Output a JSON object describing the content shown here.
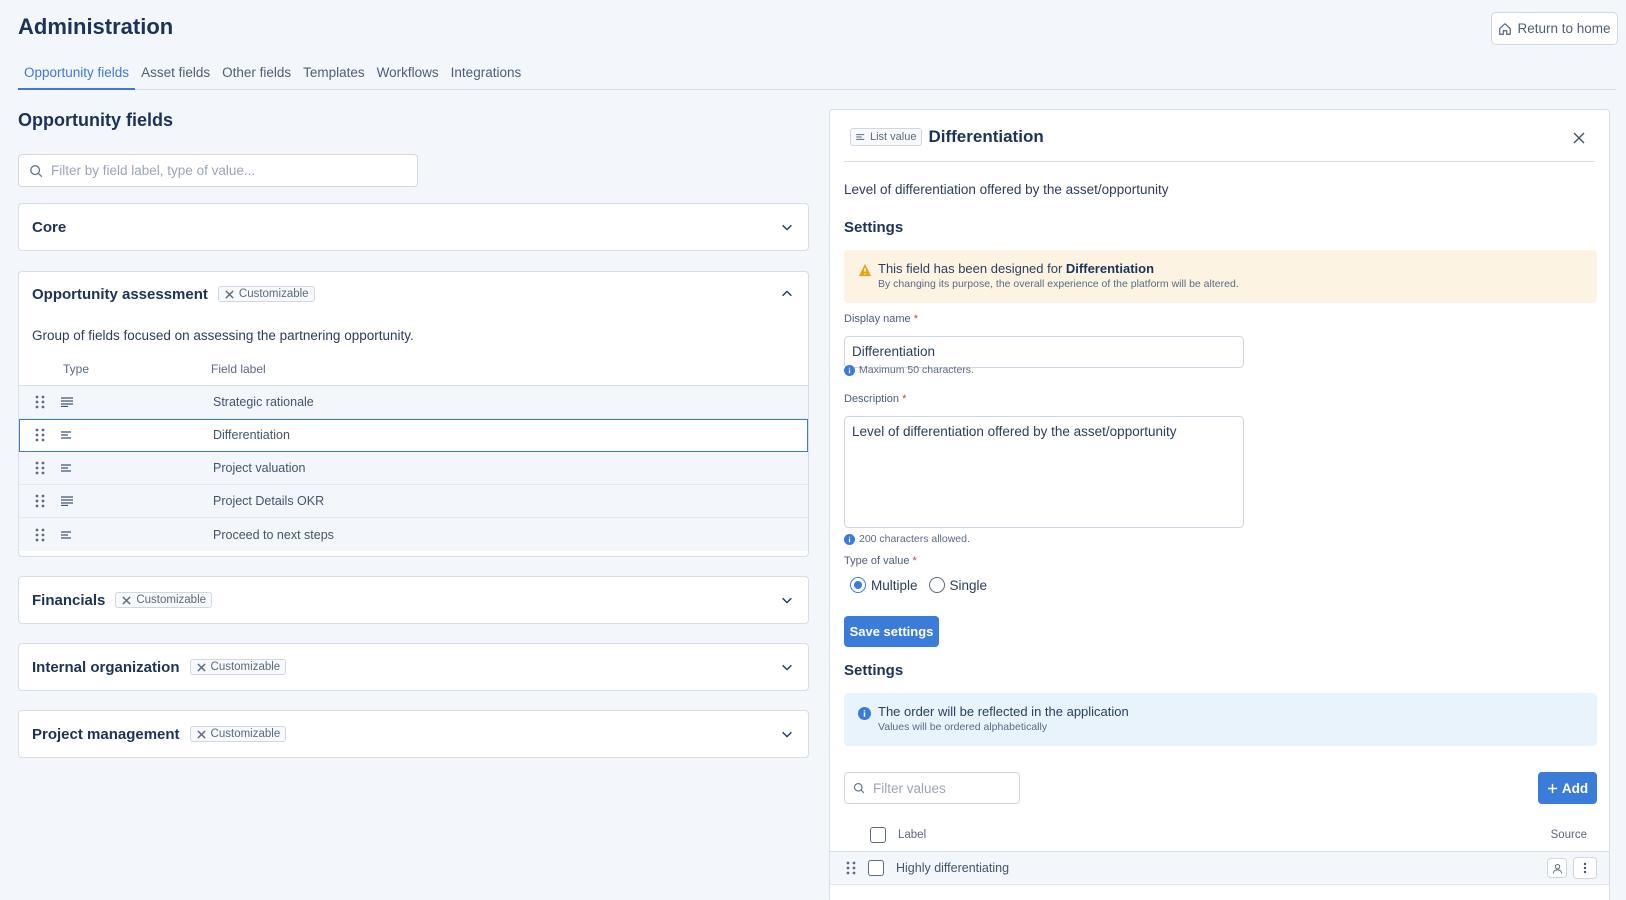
{
  "header": {
    "title": "Administration",
    "return_home": "Return to home"
  },
  "tabs": [
    "Opportunity fields",
    "Asset fields",
    "Other fields",
    "Templates",
    "Workflows",
    "Integrations"
  ],
  "main": {
    "title": "Opportunity fields",
    "filter_placeholder": "Filter by field label, type of value...",
    "customizable_label": "Customizable",
    "groups": {
      "core": "Core",
      "assessment": {
        "title": "Opportunity assessment",
        "description": "Group of fields focused on assessing the partnering opportunity.",
        "col_type": "Type",
        "col_label": "Field label",
        "rows": [
          "Strategic rationale",
          "Differentiation",
          "Project valuation",
          "Project Details OKR",
          "Proceed to next steps"
        ]
      },
      "financials": "Financials",
      "internal": "Internal organization",
      "project": "Project management"
    }
  },
  "panel": {
    "type_badge": "List value",
    "title": "Differentiation",
    "description": "Level of differentiation offered by the asset/opportunity",
    "settings_title": "Settings",
    "warning": {
      "prefix": "This field has been designed for",
      "bold": "Differentiation",
      "detail": "By changing its purpose, the overall experience of the platform will be altered."
    },
    "display_name_label": "Display name",
    "required_mark": "*",
    "display_name_value": "Differentiation",
    "display_name_hint": "Maximum 50 characters.",
    "description_label": "Description",
    "description_value": "Level of differentiation offered by the asset/opportunity",
    "description_hint": "200 characters allowed.",
    "type_of_value_label": "Type of value",
    "option_multiple": "Multiple",
    "option_single": "Single",
    "save_button": "Save settings",
    "settings2_title": "Settings",
    "info": {
      "title": "The order will be reflected in the application",
      "detail": "Values will be ordered alphabetically"
    },
    "filter_values_placeholder": "Filter values",
    "add_button": "Add",
    "col_label": "Label",
    "col_source": "Source",
    "values": [
      "Highly differentiating"
    ]
  }
}
